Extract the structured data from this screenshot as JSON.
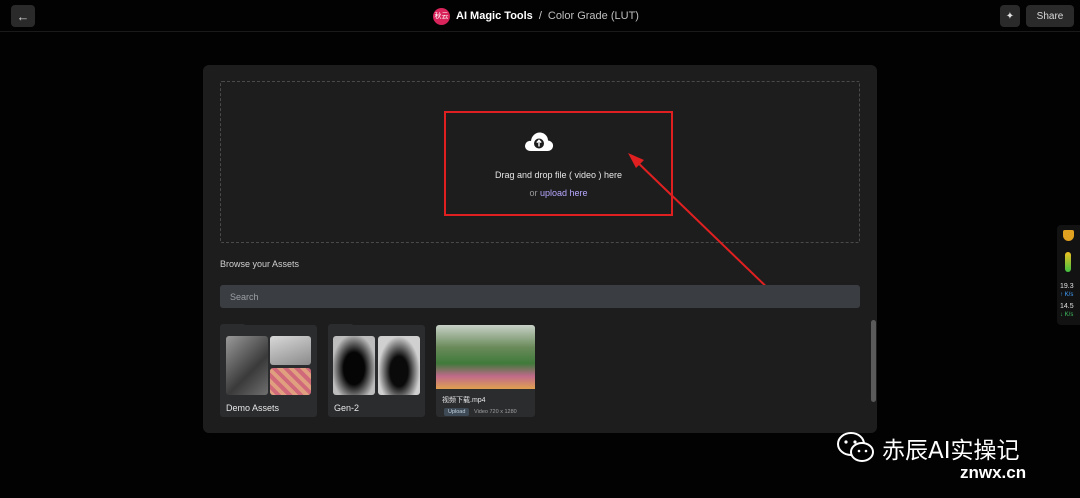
{
  "header": {
    "back_icon": "arrow-left-icon",
    "logo_text": "秋云",
    "app_name": "AI Magic Tools",
    "separator": "/",
    "tool_name": "Color Grade (LUT)",
    "sparkle_icon": "sparkle-icon",
    "share_label": "Share"
  },
  "dropzone": {
    "icon": "cloud-upload-icon",
    "instruction": "Drag and drop file ( video ) here",
    "or_text": "or ",
    "upload_link": "upload here"
  },
  "assets": {
    "browse_label": "Browse your Assets",
    "search_placeholder": "Search",
    "folders": [
      {
        "label": "Demo Assets"
      },
      {
        "label": "Gen-2"
      }
    ],
    "video": {
      "name": "视频下载.mp4",
      "badge": "Upload",
      "meta": "Video 720 x 1280"
    }
  },
  "side_widget": {
    "upload_speed": "19.3",
    "upload_unit": "↑ K/s",
    "download_speed": "14.5",
    "download_unit": "↓ K/s"
  },
  "watermark": {
    "text": "赤辰AI实操记",
    "site": "znwx.cn"
  },
  "colors": {
    "accent_link": "#b9a8ff",
    "highlight_red": "#e02020",
    "logo_pink": "#d8245a"
  }
}
